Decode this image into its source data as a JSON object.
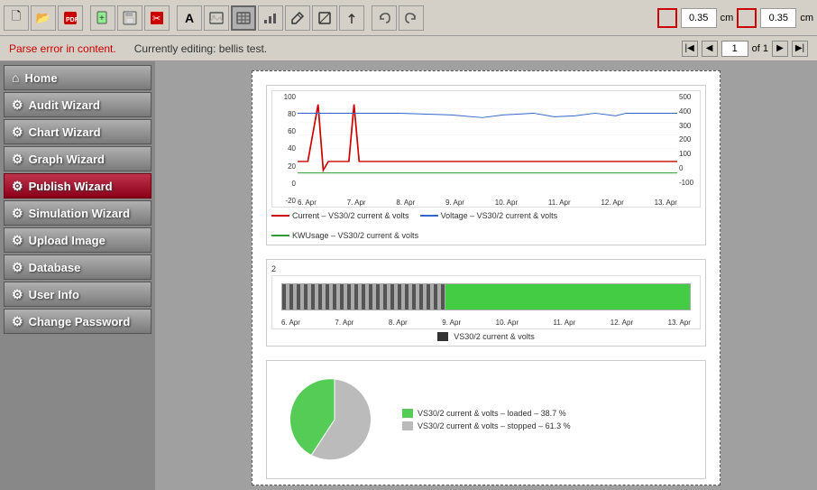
{
  "toolbar": {
    "buttons": [
      {
        "name": "new-file",
        "icon": "🗋"
      },
      {
        "name": "open-file",
        "icon": "📂"
      },
      {
        "name": "save-pdf",
        "icon": "📄"
      },
      {
        "name": "add-page",
        "icon": "➕"
      },
      {
        "name": "save-file",
        "icon": "💾"
      },
      {
        "name": "delete",
        "icon": "✂"
      },
      {
        "name": "text-tool",
        "icon": "A"
      },
      {
        "name": "image-tool",
        "icon": "🖼"
      },
      {
        "name": "table-tool",
        "icon": "▦"
      },
      {
        "name": "chart-tool",
        "icon": "📊"
      },
      {
        "name": "paint-tool",
        "icon": "✏"
      },
      {
        "name": "shape-tool",
        "icon": "◇"
      },
      {
        "name": "arrow-tool",
        "icon": "↗"
      },
      {
        "name": "undo",
        "icon": "↩"
      },
      {
        "name": "redo",
        "icon": "↪"
      }
    ],
    "width_value": "0.35",
    "width_unit": "cm",
    "height_value": "0.35",
    "height_unit": "cm"
  },
  "statusbar": {
    "error_text": "Parse error in content.",
    "info_text": "Currently editing: bellis test.",
    "page_current": "1",
    "page_total": "1"
  },
  "sidebar": {
    "items": [
      {
        "label": "Home",
        "icon": "⌂",
        "active": false
      },
      {
        "label": "Audit Wizard",
        "icon": "⚙",
        "active": false
      },
      {
        "label": "Chart Wizard",
        "icon": "⚙",
        "active": false
      },
      {
        "label": "Graph Wizard",
        "icon": "⚙",
        "active": false
      },
      {
        "label": "Publish Wizard",
        "icon": "⚙",
        "active": true
      },
      {
        "label": "Simulation Wizard",
        "icon": "⚙",
        "active": false
      },
      {
        "label": "Upload Image",
        "icon": "⚙",
        "active": false
      },
      {
        "label": "Database",
        "icon": "⚙",
        "active": false
      },
      {
        "label": "User Info",
        "icon": "⚙",
        "active": false
      },
      {
        "label": "Change Password",
        "icon": "⚙",
        "active": false
      }
    ]
  },
  "content": {
    "linechart": {
      "y_left": [
        "100",
        "80",
        "60",
        "40",
        "20",
        "0",
        "-20"
      ],
      "y_right": [
        "500",
        "400",
        "300",
        "200",
        "100",
        "0",
        "-100"
      ],
      "x_labels": [
        "6. Apr",
        "7. Apr",
        "8. Apr",
        "9. Apr",
        "10. Apr",
        "11. Apr",
        "12. Apr",
        "13. Apr"
      ],
      "legend": [
        {
          "label": "Current – VS30/2 current & volts",
          "color": "#cc0000"
        },
        {
          "label": "Voltage – VS30/2 current & volts",
          "color": "#3366cc"
        },
        {
          "label": "KWUsage – VS30/2 current & volts",
          "color": "#339933"
        }
      ]
    },
    "barchart": {
      "y_label": "2",
      "x_labels": [
        "6. Apr",
        "7. Apr",
        "8. Apr",
        "9. Apr",
        "10. Apr",
        "11. Apr",
        "12. Apr",
        "13. Apr"
      ],
      "legend": [
        {
          "label": "VS30/2 current & volts",
          "color": "#333"
        }
      ]
    },
    "piechart": {
      "slices": [
        {
          "label": "VS30/2 current & volts – loaded – 38.7 %",
          "pct": 38.7,
          "color": "#55cc55"
        },
        {
          "label": "VS30/2 current & volts – stopped – 61.3 %",
          "pct": 61.3,
          "color": "#bbbbbb"
        }
      ]
    }
  }
}
